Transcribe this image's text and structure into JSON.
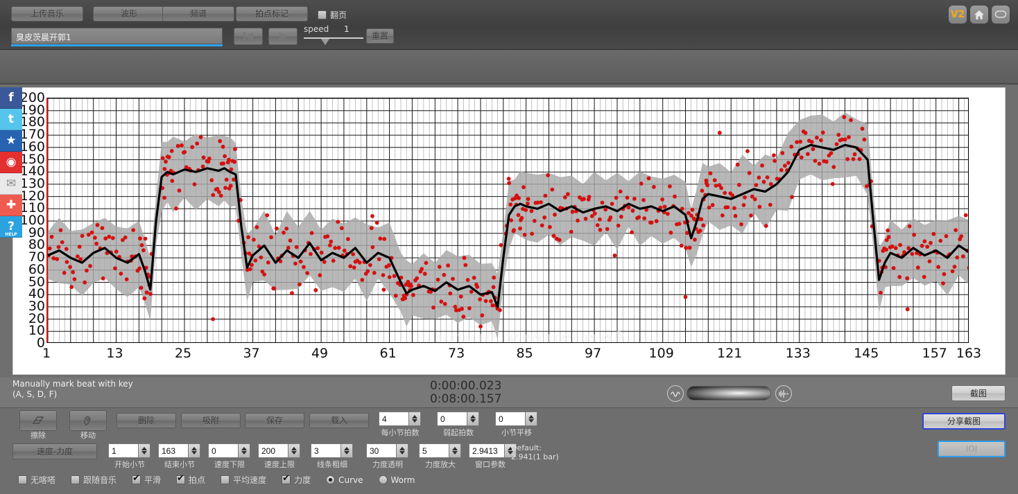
{
  "toolbar": {
    "buttons": [
      {
        "label": "上传音乐",
        "name": "upload-music-button"
      },
      {
        "label": "波形",
        "name": "waveform-button"
      },
      {
        "label": "频谱",
        "name": "spectrum-button"
      },
      {
        "label": "拍点标记",
        "name": "beat-marking-button"
      }
    ],
    "page_turn": {
      "label": "翻页",
      "checked": false
    },
    "track_name": "臭皮茨晨开郭1",
    "speed_label": "speed",
    "speed_value": "1",
    "reset_label": "重置",
    "right_icons": [
      {
        "label": "V2",
        "name": "version-badge"
      },
      {
        "label": "",
        "name": "home-icon"
      },
      {
        "label": "",
        "name": "chat-icon"
      }
    ]
  },
  "social": [
    {
      "name": "facebook-icon",
      "glyph": "f",
      "color": "#3b5998",
      "sub": ""
    },
    {
      "name": "twitter-icon",
      "glyph": "t",
      "color": "#55c5ee",
      "sub": ""
    },
    {
      "name": "qzone-icon",
      "glyph": "★",
      "color": "#2763b0",
      "sub": ""
    },
    {
      "name": "weibo-icon",
      "glyph": "◉",
      "color": "#e42f2f",
      "sub": ""
    },
    {
      "name": "email-icon",
      "glyph": "✉",
      "color": "#e9e9e9",
      "sub": ""
    },
    {
      "name": "more-share-icon",
      "glyph": "✚",
      "color": "#f05b4f",
      "sub": ""
    },
    {
      "name": "help-icon",
      "glyph": "?",
      "color": "#2aa3e0",
      "sub": "HELP"
    }
  ],
  "status": {
    "hint_line1": "Manually mark beat with key",
    "hint_line2": "(A, S, D, F)",
    "time_current": "0:00:00.023",
    "time_total": "0:08:00.157",
    "snapshot_label": "截图",
    "vol_min_icon": "volume-low-icon",
    "vol_max_icon": "volume-high-icon"
  },
  "bottom": {
    "tools": [
      {
        "label": "擦除",
        "name": "erase-tool",
        "icon": "eraser-icon"
      },
      {
        "label": "移动",
        "name": "move-tool",
        "icon": "hand-icon"
      }
    ],
    "word_buttons": [
      {
        "label": "删除",
        "name": "delete-button"
      },
      {
        "label": "吸附",
        "name": "snap-button"
      },
      {
        "label": "保存",
        "name": "save-button"
      },
      {
        "label": "载入",
        "name": "load-button"
      }
    ],
    "speed_velocity_label": "速度-力度",
    "spinners_row1": [
      {
        "value": "4",
        "label": "每小节拍数",
        "name": "beats-per-bar-spinner"
      },
      {
        "value": "0",
        "label": "弱起拍数",
        "name": "pickup-beats-spinner"
      },
      {
        "value": "0",
        "label": "小节平移",
        "name": "bar-offset-spinner"
      }
    ],
    "spinners_row2": [
      {
        "value": "1",
        "label": "开始小节",
        "name": "start-bar-spinner"
      },
      {
        "value": "163",
        "label": "结束小节",
        "name": "end-bar-spinner"
      },
      {
        "value": "0",
        "label": "速度下限",
        "name": "tempo-min-spinner"
      },
      {
        "value": "200",
        "label": "速度上限",
        "name": "tempo-max-spinner"
      },
      {
        "value": "3",
        "label": "线条粗细",
        "name": "line-width-spinner"
      },
      {
        "value": "30",
        "label": "力度透明",
        "name": "velocity-opacity-spinner"
      },
      {
        "value": "5",
        "label": "力度放大",
        "name": "velocity-scale-spinner"
      },
      {
        "value": "2.9413",
        "label": "窗口参数",
        "name": "window-param-spinner"
      }
    ],
    "default_note_line1": "Default:",
    "default_note_line2": "2.941(1 bar)",
    "checkboxes": [
      {
        "label": "无喀嗒",
        "checked": false,
        "name": "no-click-checkbox"
      },
      {
        "label": "跟随音乐",
        "checked": false,
        "name": "follow-music-checkbox"
      },
      {
        "label": "平滑",
        "checked": true,
        "name": "smooth-checkbox"
      },
      {
        "label": "拍点",
        "checked": true,
        "name": "beat-checkbox"
      },
      {
        "label": "平均速度",
        "checked": false,
        "name": "average-tempo-checkbox"
      },
      {
        "label": "力度",
        "checked": true,
        "name": "velocity-checkbox"
      }
    ],
    "radios": [
      {
        "label": "Curve",
        "checked": true,
        "name": "curve-radio"
      },
      {
        "label": "Worm",
        "checked": false,
        "name": "worm-radio"
      }
    ],
    "share_label": "分享截图",
    "ioi_label": "IOI"
  },
  "chart_data": {
    "type": "line",
    "title": "",
    "xlabel": "",
    "ylabel": "",
    "watermark": "www.xmus.net",
    "xlim": [
      1,
      163
    ],
    "ylim": [
      0,
      200
    ],
    "grid": true,
    "legend": false,
    "xticks": [
      1,
      13,
      25,
      37,
      49,
      61,
      73,
      85,
      97,
      109,
      121,
      133,
      145,
      157,
      163
    ],
    "yticks": [
      0,
      10,
      20,
      30,
      40,
      50,
      60,
      70,
      80,
      90,
      100,
      110,
      120,
      130,
      140,
      150,
      160,
      170,
      180,
      190,
      200
    ],
    "ymajor_step": 10,
    "colors": {
      "curve": "#000000",
      "band": "#a8a8a8",
      "points": "#d41111",
      "axis": "#cc1111"
    },
    "series": [
      {
        "name": "tempo_curve",
        "type": "line",
        "x": [
          1,
          3,
          5,
          7,
          9,
          11,
          13,
          15,
          17,
          18,
          19,
          20,
          21,
          22,
          23,
          25,
          27,
          29,
          31,
          32,
          33,
          34,
          35,
          36,
          37,
          39,
          41,
          43,
          45,
          47,
          49,
          51,
          53,
          55,
          57,
          59,
          61,
          63,
          64,
          65,
          67,
          69,
          71,
          73,
          75,
          77,
          79,
          80,
          81,
          82,
          83,
          84,
          85,
          87,
          89,
          91,
          93,
          95,
          97,
          99,
          101,
          103,
          105,
          107,
          109,
          111,
          113,
          114,
          115,
          116,
          117,
          119,
          121,
          123,
          125,
          127,
          129,
          131,
          133,
          135,
          137,
          139,
          141,
          143,
          145,
          146,
          147,
          148,
          149,
          151,
          153,
          155,
          157,
          159,
          161,
          163
        ],
        "values": [
          72,
          76,
          70,
          66,
          74,
          78,
          70,
          66,
          73,
          60,
          44,
          100,
          136,
          140,
          138,
          142,
          140,
          143,
          141,
          143,
          140,
          138,
          95,
          62,
          72,
          80,
          66,
          76,
          70,
          82,
          68,
          74,
          70,
          78,
          66,
          74,
          70,
          50,
          41,
          44,
          47,
          43,
          50,
          44,
          47,
          40,
          42,
          30,
          70,
          105,
          112,
          114,
          112,
          110,
          114,
          108,
          112,
          107,
          110,
          112,
          108,
          114,
          110,
          112,
          108,
          112,
          105,
          86,
          100,
          118,
          122,
          120,
          118,
          122,
          126,
          124,
          130,
          140,
          158,
          162,
          160,
          158,
          162,
          160,
          150,
          100,
          52,
          66,
          74,
          70,
          78,
          72,
          76,
          70,
          80,
          74
        ]
      },
      {
        "name": "tempo_band_upper",
        "type": "band-upper",
        "values_note": "gray confidence band upper bound, roughly curve + 18 to + 30"
      },
      {
        "name": "tempo_band_lower",
        "type": "band-lower",
        "values_note": "gray confidence band lower bound, roughly curve - 18 to - 30"
      },
      {
        "name": "beat_velocity_points",
        "type": "scatter",
        "marker": "circle",
        "color": "#d41111",
        "count_note": "~560 red beat points scattered within the gray band"
      }
    ]
  }
}
